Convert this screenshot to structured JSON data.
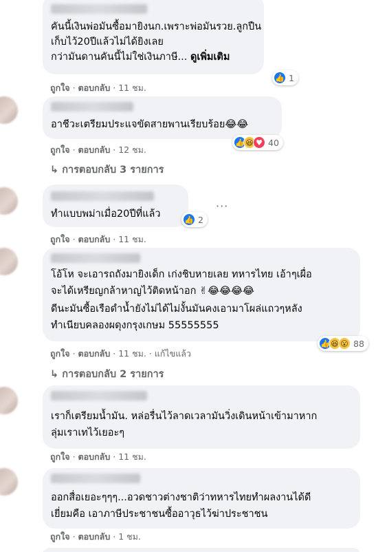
{
  "ui": {
    "like_label": "ถูกใจ",
    "reply_label": "ตอบกลับ",
    "sep": "·",
    "edited_label": "แก้ไขแล้ว",
    "more_dots": "···"
  },
  "comments": [
    {
      "lines": [
        "คันนี้เงินพ่อมันซื้อมายิงนก.เพราะพ่อมันรวย.ลูกปืน",
        "เก็บไว้20ปีแล้วไม่ได้ยิงเลย",
        "กว่ามันดานคันนี้ไม่ใช่เงินภาษี..."
      ],
      "see_more": "ดูเพิ่มเติม",
      "time": "11 ชม.",
      "reaction_count": "1"
    },
    {
      "lines": [
        "อาชีวะเตรียมประแจขัดสายพานเรียบร้อย😂😂"
      ],
      "time": "12 ชม.",
      "reaction_count": "40",
      "replies": "การตอบกลับ 3 รายการ"
    },
    {
      "lines": [
        "ทำแบบพม่าเมื่อ20ปีที่แล้ว"
      ],
      "time": "11 ชม.",
      "reaction_count": "2"
    },
    {
      "lines": [
        "โอ้โห จะเอารถถังมายิงเด็ก เก่งชิบหายเลย ทหารไทย เอ้าๆเผื่อ",
        "จะได้เหรียญกล้าหาญไว้ติดหน้าอก ✌😂😂😂😂",
        "ดีนะมันซื้อเรือดำน้ำยังไม่ได้ไม่งั้นมันคงเอามาโผล่แถวๆหลัง",
        "ทำเนียบคลองผดุงกรุงเกษม 55555555"
      ],
      "time": "11 ชม.",
      "reaction_count": "88",
      "replies": "การตอบกลับ 2 รายการ"
    },
    {
      "lines": [
        "เราก็เตรียมน้ำมัน. หล่อรื่นไว้ลาดเวลามันวิ่งเดินหน้าเข้ามาหาก",
        "ลุ่มเราเทไว้เยอะๆ"
      ],
      "time": "11 ชม."
    },
    {
      "lines": [
        "ออกสื่อเยอะๆๆๆ...อวดชาวต่างชาติว่าทหารไทยทำผลงานได้ดี",
        "เยี่ยมคือ เอาภาษีประชาชนซื้ออาวุธไว้ฆ่าประชาชน"
      ],
      "time": "1 ชม."
    }
  ]
}
